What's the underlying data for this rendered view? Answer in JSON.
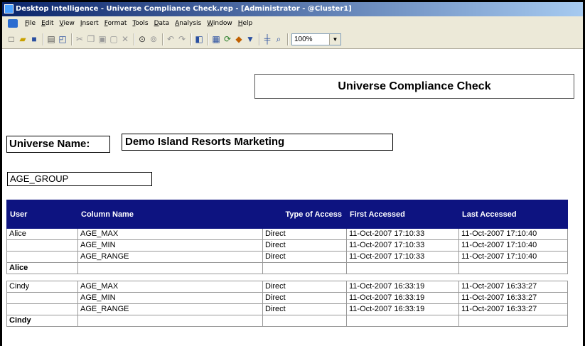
{
  "window": {
    "title": "Desktop Intelligence - Universe Compliance Check.rep - [Administrator - @Cluster1]"
  },
  "menu": [
    "File",
    "Edit",
    "View",
    "Insert",
    "Format",
    "Tools",
    "Data",
    "Analysis",
    "Window",
    "Help"
  ],
  "toolbar": {
    "icons": [
      "new-icon",
      "open-icon",
      "save-icon",
      "print-icon",
      "print-preview-icon",
      "cut-icon",
      "copy-icon",
      "paste-icon",
      "paste-special-icon",
      "delete-icon",
      "find-icon",
      "find-next-icon",
      "undo-icon",
      "redo-icon",
      "query-panel-icon",
      "table-icon",
      "refresh-icon",
      "slice-dice-icon",
      "drill-icon",
      "rotate-icon",
      "zoom-icon"
    ],
    "zoom_value": "100%"
  },
  "report": {
    "title": "Universe Compliance Check",
    "universe_label": "Universe Name:",
    "universe_value": "Demo Island Resorts Marketing",
    "group": "AGE_GROUP",
    "columns": [
      "User",
      "Column Name",
      "Type of Access",
      "First Accessed",
      "Last Accessed"
    ],
    "rows": [
      [
        "Alice",
        "AGE_MAX",
        "Direct",
        "11-Oct-2007  17:10:33",
        "11-Oct-2007  17:10:40"
      ],
      [
        "",
        "AGE_MIN",
        "Direct",
        "11-Oct-2007  17:10:33",
        "11-Oct-2007  17:10:40"
      ],
      [
        "",
        "AGE_RANGE",
        "Direct",
        "11-Oct-2007  17:10:33",
        "11-Oct-2007  17:10:40"
      ],
      [
        "Cindy",
        "AGE_MAX",
        "Direct",
        "11-Oct-2007  16:33:19",
        "11-Oct-2007  16:33:27"
      ],
      [
        "",
        "AGE_MIN",
        "Direct",
        "11-Oct-2007  16:33:19",
        "11-Oct-2007  16:33:27"
      ],
      [
        "",
        "AGE_RANGE",
        "Direct",
        "11-Oct-2007  16:33:19",
        "11-Oct-2007  16:33:27"
      ]
    ],
    "totals": [
      "Alice",
      "Cindy"
    ]
  }
}
